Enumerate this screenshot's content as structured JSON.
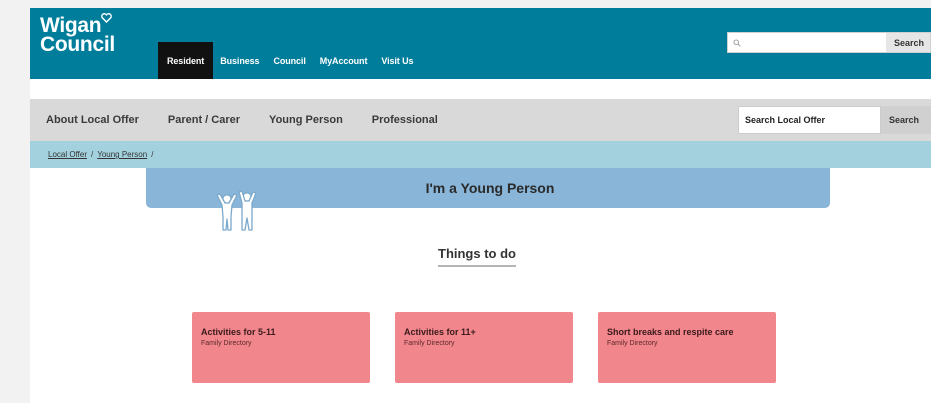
{
  "header": {
    "logo_line1": "Wigan",
    "logo_line2": "Council",
    "nav": [
      "Resident",
      "Business",
      "Council",
      "MyAccount",
      "Visit Us"
    ],
    "active_nav": "Resident",
    "search": {
      "placeholder": "",
      "button": "Search"
    }
  },
  "local_offer_nav": {
    "items": [
      "About Local Offer",
      "Parent / Carer",
      "Young Person",
      "Professional"
    ],
    "search": {
      "placeholder": "Search Local Offer",
      "button": "Search"
    }
  },
  "breadcrumb": [
    "Local Offer",
    "Young Person"
  ],
  "banner": {
    "title": "I'm a Young Person"
  },
  "section": {
    "title": "Things to do"
  },
  "cards": [
    {
      "title": "Activities for 5-11",
      "subtitle": "Family Directory"
    },
    {
      "title": "Activities for 11+",
      "subtitle": "Family Directory"
    },
    {
      "title": "Short breaks and respite care",
      "subtitle": "Family Directory"
    }
  ],
  "colors": {
    "header": "#017d9c",
    "active_nav": "#111111",
    "local_nav": "#d9d9d9",
    "breadcrumb": "#a3d2de",
    "banner": "#88b5d8",
    "card": "#f2868d"
  },
  "icons": [
    "heart-icon",
    "search-icon",
    "young-people-icon"
  ]
}
